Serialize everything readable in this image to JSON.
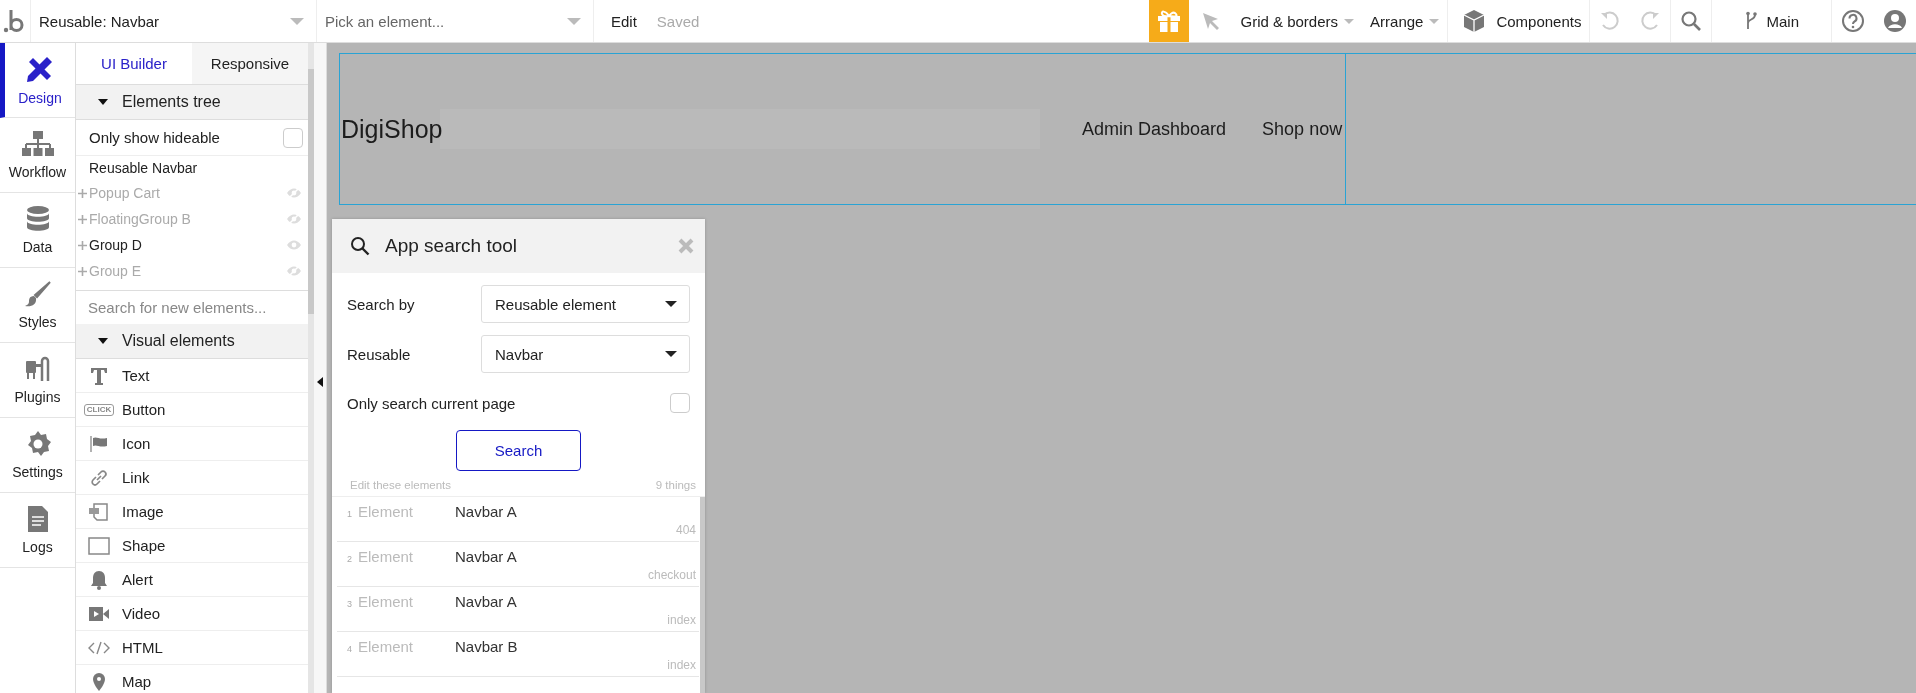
{
  "topbar": {
    "reusable_select": "Reusable: Navbar",
    "element_select": {
      "placeholder": "Pick an element..."
    },
    "edit": "Edit",
    "status": "Saved",
    "grid": "Grid & borders",
    "arrange": "Arrange",
    "components": "Components",
    "branch": "Main"
  },
  "rail": [
    {
      "kind": "design",
      "label": "Design",
      "selected": true
    },
    {
      "kind": "workflow",
      "label": "Workflow",
      "selected": false
    },
    {
      "kind": "data",
      "label": "Data",
      "selected": false
    },
    {
      "kind": "styles",
      "label": "Styles",
      "selected": false
    },
    {
      "kind": "plugins",
      "label": "Plugins",
      "selected": false
    },
    {
      "kind": "settings",
      "label": "Settings",
      "selected": false
    },
    {
      "kind": "logs",
      "label": "Logs",
      "selected": false
    }
  ],
  "panel_tabs": [
    {
      "label": "UI Builder",
      "selected": true
    },
    {
      "label": "Responsive",
      "selected": false
    }
  ],
  "elements_tree": {
    "title": "Elements tree",
    "only_hideable": {
      "label": "Only show hideable",
      "checked": false
    },
    "root": "Reusable Navbar",
    "items": [
      {
        "label": "Popup Cart",
        "visible": false
      },
      {
        "label": "FloatingGroup B",
        "visible": false
      },
      {
        "label": "Group D",
        "visible": true
      },
      {
        "label": "Group E",
        "visible": false
      }
    ]
  },
  "element_search": {
    "placeholder": "Search for new elements..."
  },
  "visual_elements": {
    "title": "Visual elements",
    "items": [
      {
        "kind": "text",
        "label": "Text"
      },
      {
        "kind": "button",
        "label": "Button",
        "icon_text": "CLICK"
      },
      {
        "kind": "icon",
        "label": "Icon"
      },
      {
        "kind": "link",
        "label": "Link"
      },
      {
        "kind": "image",
        "label": "Image"
      },
      {
        "kind": "shape",
        "label": "Shape"
      },
      {
        "kind": "alert",
        "label": "Alert"
      },
      {
        "kind": "video",
        "label": "Video"
      },
      {
        "kind": "html",
        "label": "HTML"
      },
      {
        "kind": "map",
        "label": "Map"
      }
    ]
  },
  "navbar": {
    "logo": "DigiShop",
    "links": [
      "Admin Dashboard",
      "Shop now"
    ]
  },
  "search_tool": {
    "title": "App search tool",
    "search_by": {
      "label": "Search by",
      "value": "Reusable element"
    },
    "reusable": {
      "label": "Reusable",
      "value": "Navbar"
    },
    "current_page": {
      "label": "Only search current page",
      "checked": false
    },
    "button": "Search",
    "results_label": "Edit these elements",
    "count": "9 things",
    "results": [
      {
        "index": "1",
        "type": "Element",
        "name": "Navbar A",
        "page": "404"
      },
      {
        "index": "2",
        "type": "Element",
        "name": "Navbar A",
        "page": "checkout"
      },
      {
        "index": "3",
        "type": "Element",
        "name": "Navbar A",
        "page": "index"
      },
      {
        "index": "4",
        "type": "Element",
        "name": "Navbar B",
        "page": "index"
      }
    ]
  }
}
